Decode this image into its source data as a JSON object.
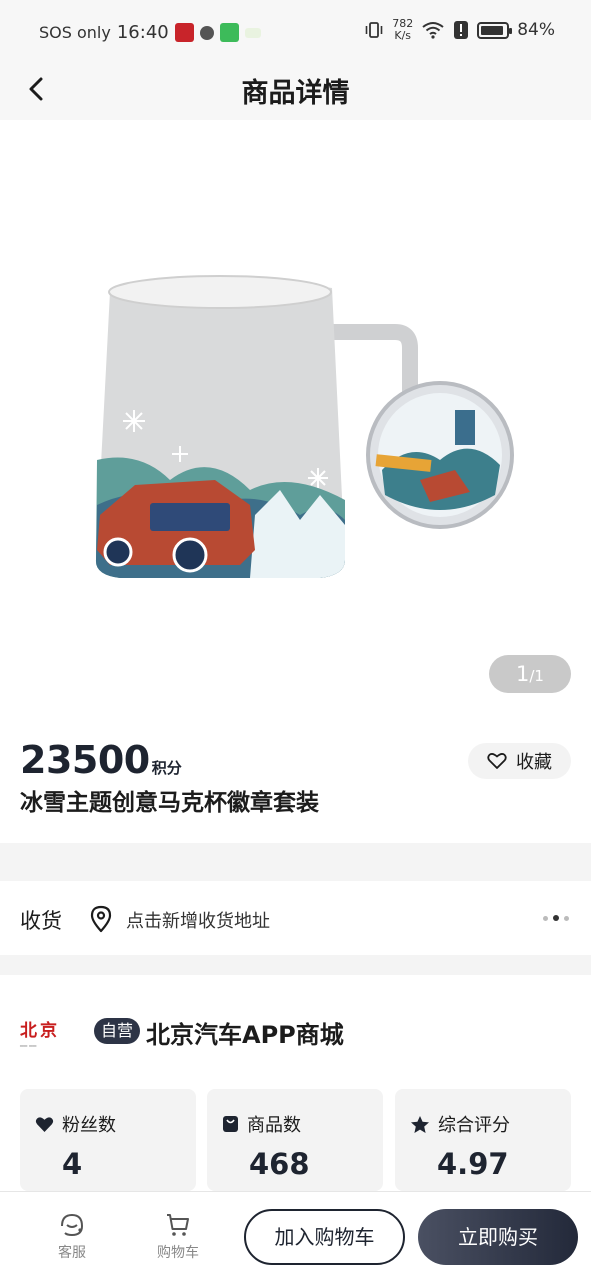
{
  "status_bar": {
    "carrier": "SOS only",
    "time": "16:40",
    "net_speed_value": "782",
    "net_speed_unit": "K/s",
    "battery": "84%",
    "battery_level": 0.84
  },
  "nav": {
    "title": "商品详情"
  },
  "gallery": {
    "current": "1",
    "total": "/1"
  },
  "product": {
    "price": "23500",
    "price_unit": "积分",
    "name": "冰雪主题创意马克杯徽章套装",
    "favorite_label": "收藏"
  },
  "address": {
    "label": "收货",
    "placeholder": "点击新增收货地址"
  },
  "store": {
    "logo_text": "北京",
    "badge": "自营",
    "name": "北京汽车APP商城"
  },
  "stats": [
    {
      "label": "粉丝数",
      "value": "4",
      "icon": "heart-icon"
    },
    {
      "label": "商品数",
      "value": "468",
      "icon": "shopping-bag-icon"
    },
    {
      "label": "综合评分",
      "value": "4.97",
      "icon": "star-icon"
    }
  ],
  "bottom_bar": {
    "service_label": "客服",
    "cart_label": "购物车",
    "add_to_cart": "加入购物车",
    "buy_now": "立即购买"
  },
  "colors": {
    "primary_dark": "#1e2430",
    "badge_bg": "#2d3446",
    "logo_red": "#c81e1e",
    "section_gap": "#f4f4f4"
  }
}
